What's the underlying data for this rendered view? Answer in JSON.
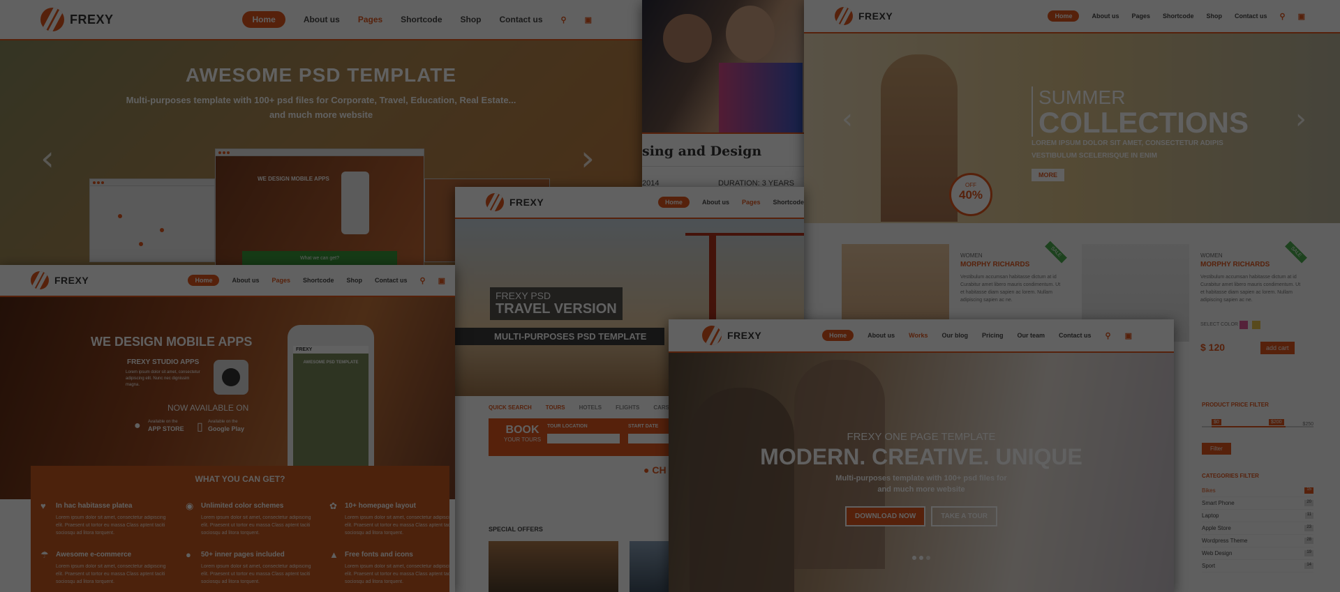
{
  "brand": {
    "name": "FREXY",
    "accent": "#e2581f"
  },
  "menu_main": [
    "Home",
    "About us",
    "Pages",
    "Shortcode",
    "Shop",
    "Contact us"
  ],
  "menu_pages": [
    "Home",
    "About us",
    "Pages",
    "Shortcode"
  ],
  "menu_onepage": [
    "Home",
    "About us",
    "Works",
    "Our blog",
    "Pricing",
    "Our team",
    "Contact us"
  ],
  "psd": {
    "title": "AWESOME PSD TEMPLATE",
    "sub1": "Multi-purposes template with 100+ psd files for Corporate, Travel, Education, Real Estate...",
    "sub2": "and much more website",
    "mini_heading": "WE DESIGN MOBILE APPS",
    "mini_bar": "What we can get?"
  },
  "edu": {
    "course": "sing and Design",
    "year": "2014",
    "duration": "DURATION: 3 YEARS"
  },
  "fashion": {
    "summer": "SUMMER",
    "collections": "COLLECTIONS",
    "desc1": "LOREM IPSUM DOLOR SIT AMET, CONSECTETUR ADIPIS",
    "desc2": "VESTIBULUM SCELERISQUE IN ENIM",
    "more": "MORE",
    "off": "OFF",
    "pct": "40%",
    "p1_cat": "WOMEN",
    "p1_name": "MORPHY RICHARDS",
    "p2_cat": "WOMEN",
    "p2_name": "MORPHY RICHARDS",
    "sale": "SALE",
    "desc_text": "Vestibulum accumsan habitasse dictum at id Curabitur amet libero mauris condimentum. Ut et habitasse diam sapien ac lorem. Nullam adipiscing sapien ac ne.",
    "select_color": "SELECT COLOR",
    "price": "$ 120",
    "add_cart": "add cart",
    "filter_title": "PRODUCT PRICE FILTER",
    "price_lo": "$0",
    "price_hi": "$200",
    "price_max": "$250",
    "filter_btn": "Filter",
    "cat_title": "CATEGORIES FILTER",
    "categories": [
      {
        "name": "Bikes",
        "count": "15"
      },
      {
        "name": "Smart Phone",
        "count": "20"
      },
      {
        "name": "Laptop",
        "count": "11"
      },
      {
        "name": "Apple Store",
        "count": "23"
      },
      {
        "name": "Wordpress Theme",
        "count": "28"
      },
      {
        "name": "Web Design",
        "count": "19"
      },
      {
        "name": "Sport",
        "count": "14"
      }
    ]
  },
  "apps": {
    "heading": "WE DESIGN MOBILE APPS",
    "studio": "FREXY STUDIO APPS",
    "lorem": "Lorem ipsum dolor sit amet, consectetur adipiscing elit. Nunc nec dignissim magna.",
    "now": "NOW AVAILABLE ON",
    "avail": "Available on the",
    "app_store": "APP STORE",
    "google_play": "Google Play",
    "phone_title": "AWESOME PSD TEMPLATE",
    "what": "WHAT YOU CAN GET?",
    "features": [
      {
        "title": "In hac habitasse platea",
        "icon": "heart-icon"
      },
      {
        "title": "Unlimited color schemes",
        "icon": "camera-icon"
      },
      {
        "title": "10+ homepage layout",
        "icon": "leaf-icon"
      },
      {
        "title": "Awesome e-commerce",
        "icon": "umbrella-icon"
      },
      {
        "title": "50+ inner pages included",
        "icon": "apple-icon"
      },
      {
        "title": "Free fonts and icons",
        "icon": "sitemap-icon"
      }
    ],
    "feature_desc": "Lorem ipsum dolor sit amet, consectetur adipiscing elit. Praesent ut tortor eu massa Class aptent taciti sociosqu ad litora torquent."
  },
  "travel": {
    "psd": "FREXY PSD",
    "version": "TRAVEL VERSION",
    "multi": "MULTI-PURPOSES PSD TEMPLATE",
    "quick": "QUICK SEARCH",
    "tabs": [
      "TOURS",
      "HOTELS",
      "FLIGHTS",
      "CARS"
    ],
    "book": "BOOK",
    "your_tours": "YOUR TOURS",
    "loc": "TOUR LOCATION",
    "date": "START DATE",
    "special": "SPECIAL OFFERS",
    "pin_text": "CH"
  },
  "onepage": {
    "kicker": "FREXY ONE PAGE TEMPLATE",
    "title": "MODERN. CREATIVE. UNIQUE",
    "sub1": "Multi-purposes template with 100+ psd files for",
    "sub2": "and much more website",
    "download": "DOWNLOAD NOW",
    "tour": "TAKE A TOUR"
  }
}
